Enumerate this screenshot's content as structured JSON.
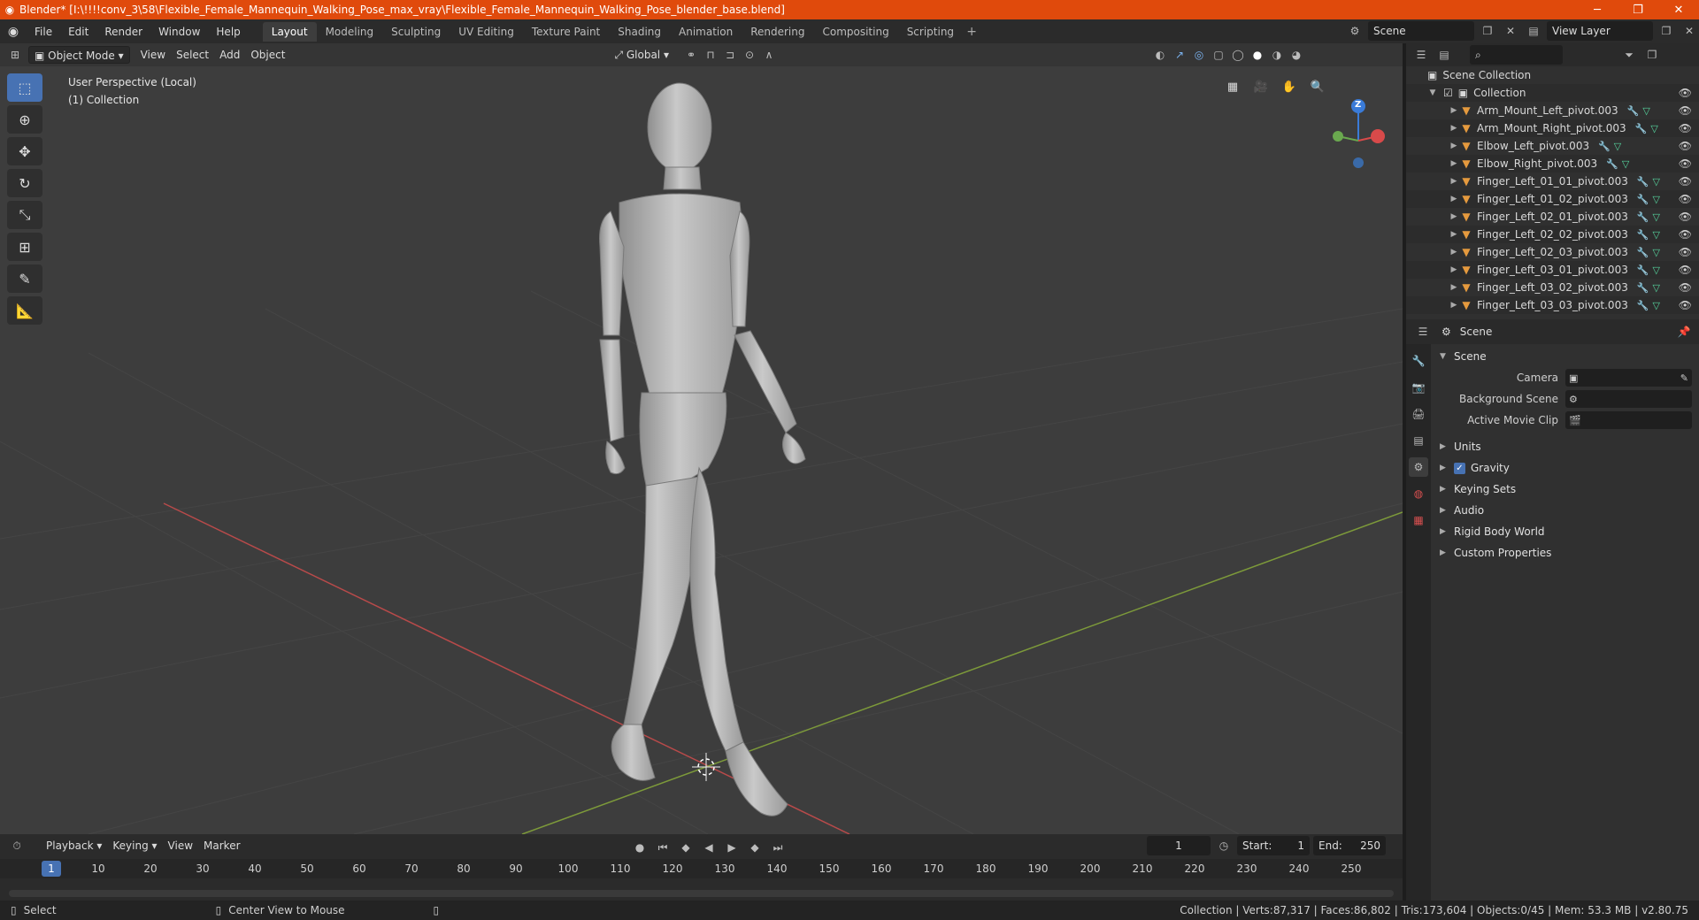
{
  "window": {
    "title": "Blender* [I:\\!!!!conv_3\\58\\Flexible_Female_Mannequin_Walking_Pose_max_vray\\Flexible_Female_Mannequin_Walking_Pose_blender_base.blend]"
  },
  "menus": [
    "File",
    "Edit",
    "Render",
    "Window",
    "Help"
  ],
  "workspaces": [
    "Layout",
    "Modeling",
    "Sculpting",
    "UV Editing",
    "Texture Paint",
    "Shading",
    "Animation",
    "Rendering",
    "Compositing",
    "Scripting"
  ],
  "scene_field": "Scene",
  "view_layer_field": "View Layer",
  "viewport": {
    "mode": "Object Mode",
    "menus": [
      "View",
      "Select",
      "Add",
      "Object"
    ],
    "transform": "Global",
    "info_line1": "User Perspective (Local)",
    "info_line2": "(1) Collection",
    "gizmo_z": "Z"
  },
  "outliner": {
    "scene_collection": "Scene Collection",
    "collection": "Collection",
    "items": [
      "Arm_Mount_Left_pivot.003",
      "Arm_Mount_Right_pivot.003",
      "Elbow_Left_pivot.003",
      "Elbow_Right_pivot.003",
      "Finger_Left_01_01_pivot.003",
      "Finger_Left_01_02_pivot.003",
      "Finger_Left_02_01_pivot.003",
      "Finger_Left_02_02_pivot.003",
      "Finger_Left_02_03_pivot.003",
      "Finger_Left_03_01_pivot.003",
      "Finger_Left_03_02_pivot.003",
      "Finger_Left_03_03_pivot.003"
    ]
  },
  "properties": {
    "header": "Scene",
    "panel": "Scene",
    "camera_label": "Camera",
    "background_scene_label": "Background Scene",
    "active_movie_clip_label": "Active Movie Clip",
    "subpanels": [
      "Units",
      "Gravity",
      "Keying Sets",
      "Audio",
      "Rigid Body World",
      "Custom Properties"
    ]
  },
  "timeline": {
    "menus": [
      "Playback",
      "Keying",
      "View",
      "Marker"
    ],
    "current_frame": "1",
    "start_label": "Start:",
    "start": "1",
    "end_label": "End:",
    "end": "250",
    "ticks": [
      "10",
      "20",
      "30",
      "40",
      "50",
      "60",
      "70",
      "80",
      "90",
      "100",
      "110",
      "120",
      "130",
      "140",
      "150",
      "160",
      "170",
      "180",
      "190",
      "200",
      "210",
      "220",
      "230",
      "240",
      "250"
    ],
    "frame_marker": "1"
  },
  "status": {
    "select": "Select",
    "center_view": "Center View to Mouse",
    "stats": "Collection | Verts:87,317 | Faces:86,802 | Tris:173,604 | Objects:0/45 | Mem: 53.3 MB | v2.80.75"
  }
}
